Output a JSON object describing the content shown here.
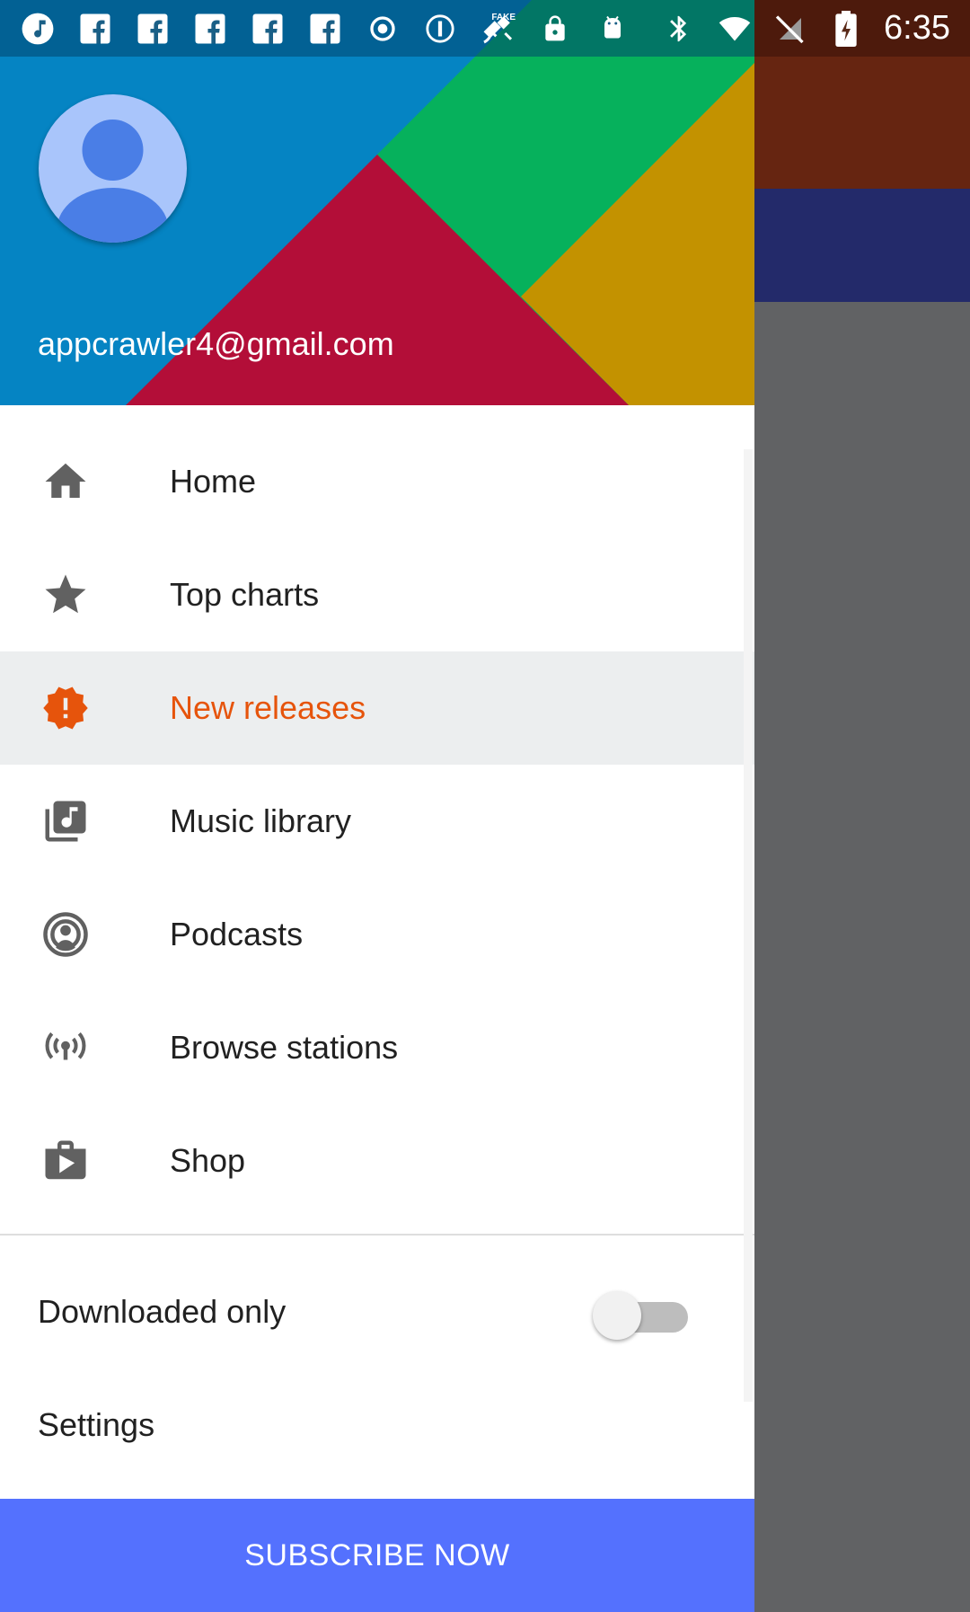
{
  "status_bar": {
    "time": "6:35",
    "left_icons": [
      "music-note-icon",
      "facebook-icon",
      "facebook-icon",
      "facebook-icon",
      "facebook-icon",
      "facebook-icon",
      "record-icon",
      "info-icon",
      "fake-gps-icon",
      "lock-icon",
      "android-icon"
    ],
    "right_icons": [
      "bluetooth-icon",
      "wifi-icon",
      "no-sim-icon",
      "battery-charging-icon"
    ]
  },
  "drawer": {
    "header": {
      "email": "appcrawler4@gmail.com",
      "colors": {
        "blue": "#0584c3",
        "green": "#06b15c",
        "red": "#b30e38",
        "yellow": "#c39200"
      }
    },
    "menu": [
      {
        "label": "Home",
        "icon": "home-icon",
        "active": false
      },
      {
        "label": "Top charts",
        "icon": "star-icon",
        "active": false
      },
      {
        "label": "New releases",
        "icon": "new-releases-icon",
        "active": true
      },
      {
        "label": "Music library",
        "icon": "music-library-icon",
        "active": false
      },
      {
        "label": "Podcasts",
        "icon": "podcast-icon",
        "active": false
      },
      {
        "label": "Browse stations",
        "icon": "radio-station-icon",
        "active": false
      },
      {
        "label": "Shop",
        "icon": "shop-icon",
        "active": false
      }
    ],
    "downloaded_only": {
      "label": "Downloaded only",
      "enabled": false
    },
    "settings": {
      "label": "Settings"
    },
    "subscribe": {
      "label": "SUBSCRIBE NOW",
      "color": "#5471fe"
    },
    "accent_color": "#e6540c"
  }
}
